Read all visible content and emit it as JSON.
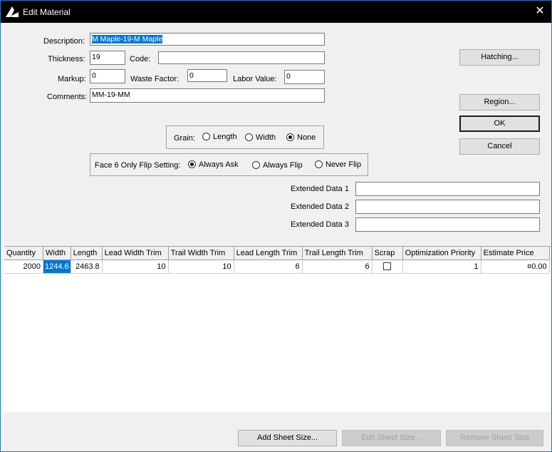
{
  "window": {
    "title": "Edit Material",
    "close_glyph": "✕"
  },
  "form": {
    "description_label": "Description:",
    "description_value": "M Maple-19-M Maple",
    "thickness_label": "Thickness:",
    "thickness_value": "19",
    "code_label": "Code:",
    "code_value": "",
    "markup_label": "Markup:",
    "markup_value": "0",
    "waste_factor_label": "Waste Factor:",
    "waste_factor_value": "0",
    "labor_value_label": "Labor Value:",
    "labor_value_value": "0",
    "comments_label": "Comments:",
    "comments_value": "MM-19-MM"
  },
  "grain": {
    "label": "Grain:",
    "options": [
      "Length",
      "Width",
      "None"
    ],
    "selected": "None"
  },
  "flip": {
    "label": "Face 6 Only Flip Setting:",
    "options": [
      "Always Ask",
      "Always Flip",
      "Never Flip"
    ],
    "selected": "Always Ask"
  },
  "extended": {
    "label1": "Extended Data 1",
    "value1": "",
    "label2": "Extended Data 2",
    "value2": "",
    "label3": "Extended Data 3",
    "value3": ""
  },
  "buttons": {
    "hatching": "Hatching...",
    "region": "Region...",
    "ok": "OK",
    "cancel": "Cancel",
    "add_sheet": "Add Sheet Size...",
    "edit_sheet": "Edit Sheet Size...",
    "remove_sheet": "Remove Sheet Size"
  },
  "grid": {
    "columns": [
      "Quantity",
      "Width",
      "Length",
      "Lead Width Trim",
      "Trail Width Trim",
      "Lead Length Trim",
      "Trail Length Trim",
      "Scrap",
      "Optimization Priority",
      "Estimate Price"
    ],
    "rows": [
      {
        "quantity": "2000",
        "width": "1244.6",
        "length": "2463.8",
        "lead_width_trim": "10",
        "trail_width_trim": "10",
        "lead_length_trim": "6",
        "trail_length_trim": "6",
        "scrap": false,
        "optimization_priority": "1",
        "estimate_price": "¤0.00"
      }
    ]
  },
  "icons": {
    "app": "app-logo-icon",
    "close": "close-icon"
  }
}
